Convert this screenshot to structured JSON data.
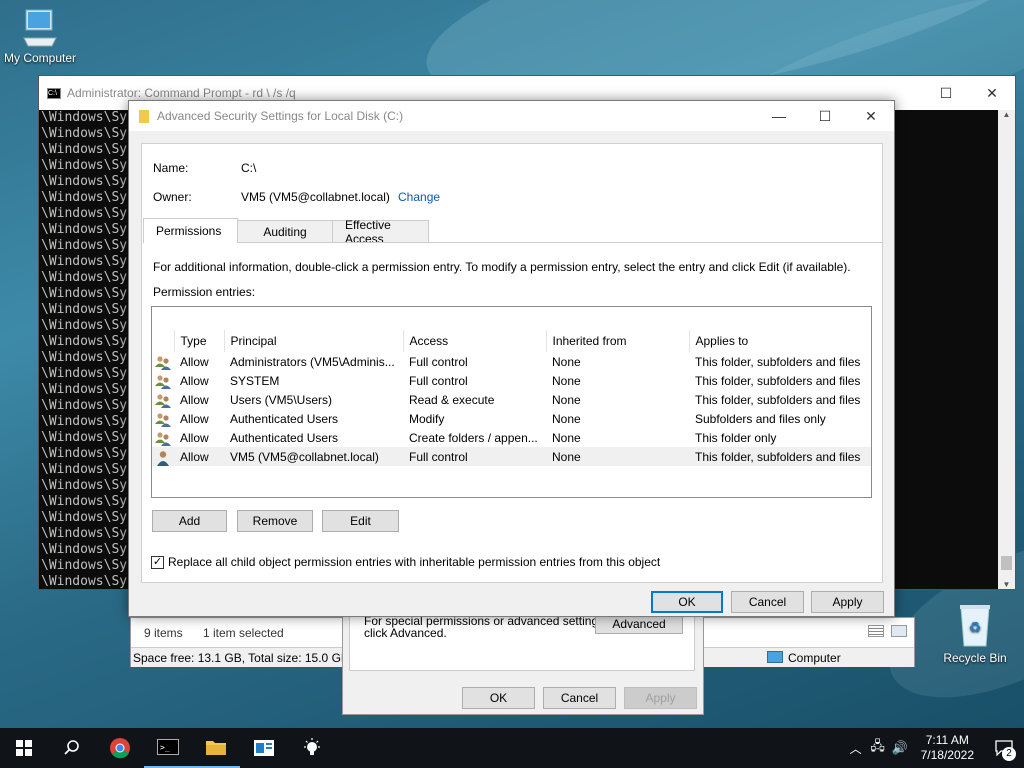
{
  "desktop": {
    "my_computer": "My Computer",
    "recycle_bin": "Recycle Bin"
  },
  "cmd": {
    "title": "Administrator: Command Prompt - rd  \\ /s /q",
    "line": "\\Windows\\Sy",
    "line_count": 30
  },
  "explorer": {
    "items_count": "9 items",
    "selected": "1 item selected",
    "space": "Space free: 13.1 GB, Total size: 15.0 GB",
    "computer": "Computer"
  },
  "props": {
    "text1": "For special permissions or advanced settings,",
    "text2": "click Advanced.",
    "advanced": "Advanced",
    "ok": "OK",
    "cancel": "Cancel",
    "apply": "Apply"
  },
  "dialog": {
    "title": "Advanced Security Settings for Local Disk (C:)",
    "name_label": "Name:",
    "name_value": "C:\\",
    "owner_label": "Owner:",
    "owner_value": "VM5 (VM5@collabnet.local)",
    "change": "Change",
    "tabs": [
      "Permissions",
      "Auditing",
      "Effective Access"
    ],
    "info": "For additional information, double-click a permission entry. To modify a permission entry, select the entry and click Edit (if available).",
    "entries_label": "Permission entries:",
    "columns": [
      "Type",
      "Principal",
      "Access",
      "Inherited from",
      "Applies to"
    ],
    "rows": [
      {
        "type": "Allow",
        "principal": "Administrators (VM5\\Adminis...",
        "access": "Full control",
        "inherited": "None",
        "applies": "This folder, subfolders and files",
        "icon": "group"
      },
      {
        "type": "Allow",
        "principal": "SYSTEM",
        "access": "Full control",
        "inherited": "None",
        "applies": "This folder, subfolders and files",
        "icon": "group"
      },
      {
        "type": "Allow",
        "principal": "Users (VM5\\Users)",
        "access": "Read & execute",
        "inherited": "None",
        "applies": "This folder, subfolders and files",
        "icon": "group"
      },
      {
        "type": "Allow",
        "principal": "Authenticated Users",
        "access": "Modify",
        "inherited": "None",
        "applies": "Subfolders and files only",
        "icon": "group"
      },
      {
        "type": "Allow",
        "principal": "Authenticated Users",
        "access": "Create folders / appen...",
        "inherited": "None",
        "applies": "This folder only",
        "icon": "group"
      },
      {
        "type": "Allow",
        "principal": "VM5 (VM5@collabnet.local)",
        "access": "Full control",
        "inherited": "None",
        "applies": "This folder, subfolders and files",
        "icon": "user",
        "selected": true
      }
    ],
    "add": "Add",
    "remove": "Remove",
    "edit": "Edit",
    "replace_label": "Replace all child object permission entries with inheritable permission entries from this object",
    "replace_checked": true,
    "ok": "OK",
    "cancel": "Cancel",
    "apply": "Apply"
  },
  "taskbar": {
    "time": "7:11 AM",
    "date": "7/18/2022",
    "notifications": "2"
  }
}
